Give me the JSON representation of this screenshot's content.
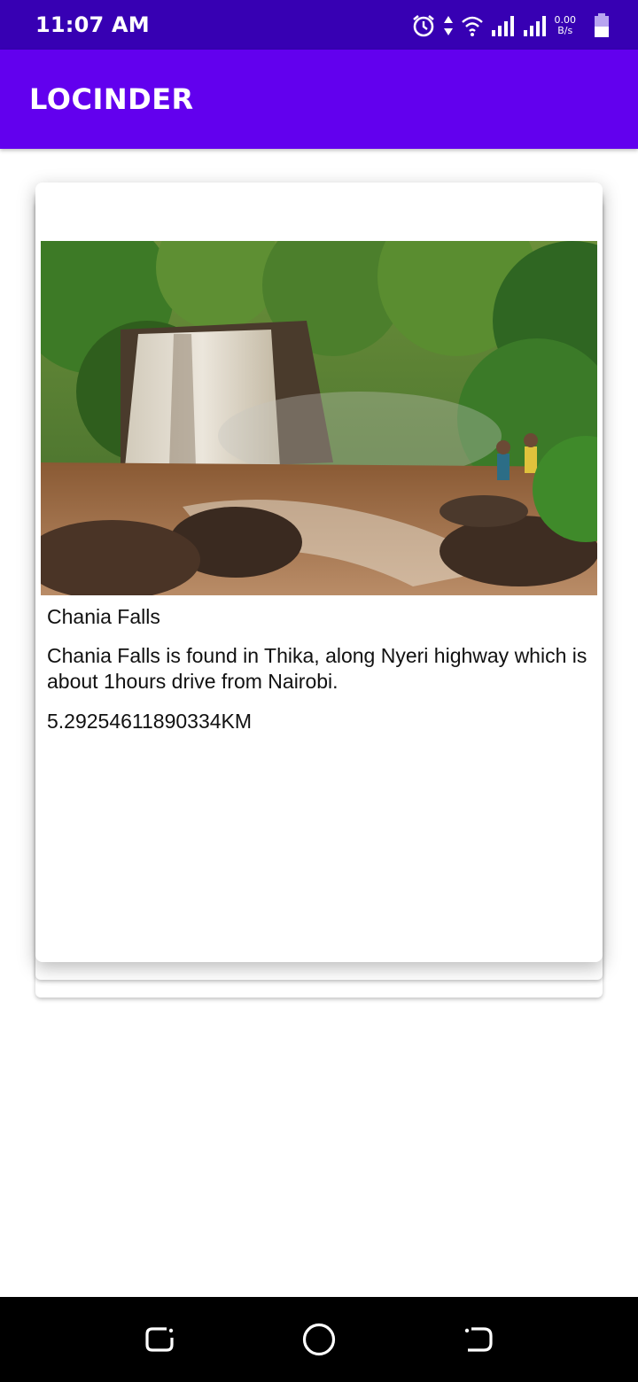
{
  "status_bar": {
    "time": "11:07 AM",
    "net_speed_value": "0.00",
    "net_speed_unit": "B/s",
    "icons": [
      "alarm-icon",
      "data-arrows-icon",
      "wifi-icon",
      "signal-icon",
      "signal-icon",
      "battery-icon"
    ]
  },
  "app_bar": {
    "title": "LOCINDER"
  },
  "card": {
    "name": "Chania Falls",
    "description": "Chania Falls is found in Thika, along Nyeri highway which is about 1hours drive from Nairobi.",
    "distance": "5.29254611890334KM"
  },
  "nav_bar": {
    "icons": [
      "recents-icon",
      "home-icon",
      "back-icon"
    ]
  },
  "colors": {
    "status_bar": "#3700b3",
    "app_bar": "#6200ee",
    "nav_bar": "#000000"
  }
}
